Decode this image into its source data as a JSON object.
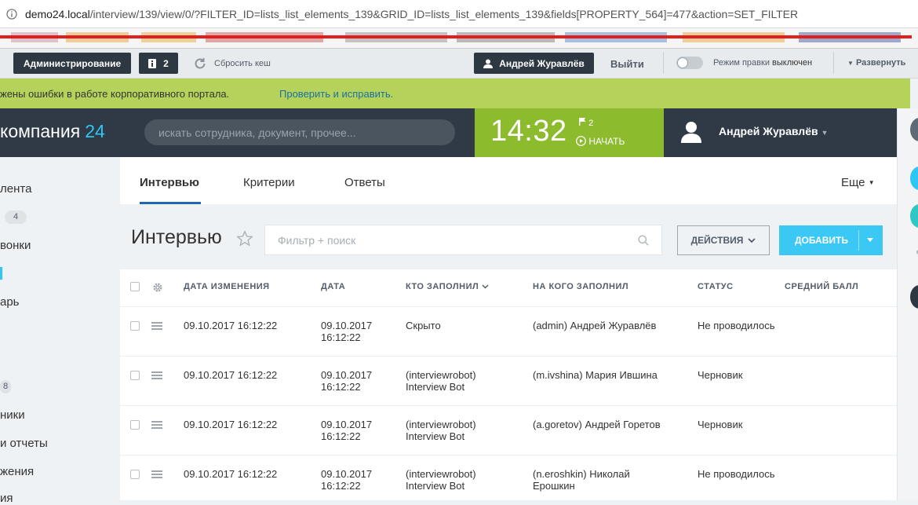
{
  "browser": {
    "url_host": "demo24.local",
    "url_rest": "/interview/139/view/0/?FILTER_ID=lists_list_elements_139&GRID_ID=lists_list_elements_139&fields[PROPERTY_564]=477&action=SET_FILTER"
  },
  "admin_bar": {
    "admin_label": "Администрирование",
    "notif_count": "2",
    "clear_cache": "Сбросить кеш",
    "user_name": "Андрей Журавлёв",
    "logout": "Выйти",
    "edit_mode_label": "Режим правки",
    "edit_mode_state": "выключен",
    "expand": "Развернуть"
  },
  "warning": {
    "message": "жены ошибки в работе корпоративного портала.",
    "link": "Проверить и исправить."
  },
  "header": {
    "logo_text": "компания",
    "logo_suffix": "24",
    "search_placeholder": "искать сотрудника, документ, прочее...",
    "time": "14:32",
    "flag_count": "2",
    "start_label": "НАЧАТЬ",
    "user_name": "Андрей Журавлёв"
  },
  "sidebar": {
    "items": [
      "лента",
      "вонки",
      "",
      "арь",
      "ники",
      "и отчеты",
      "жения",
      "ия"
    ],
    "counters": [
      "4",
      "8"
    ]
  },
  "tabs": [
    "Интервью",
    "Критерии",
    "Ответы"
  ],
  "tabs_more": "Еще",
  "page": {
    "title": "Интервью",
    "filter_placeholder": "Фильтр + поиск",
    "actions_label": "ДЕЙСТВИЯ",
    "add_label": "ДОБАВИТЬ"
  },
  "grid": {
    "columns": [
      "ДАТА ИЗМЕНЕНИЯ",
      "ДАТА",
      "КТО ЗАПОЛНИЛ",
      "НА КОГО ЗАПОЛНИЛ",
      "СТАТУС",
      "СРЕДНИЙ БАЛЛ"
    ],
    "rows": [
      {
        "modified": "09.10.2017 16:12:22",
        "date": "09.10.2017 16:12:22",
        "who": "Скрыто",
        "whom": "(admin) Андрей Журавлёв",
        "status": "Не проводилось",
        "score": ""
      },
      {
        "modified": "09.10.2017 16:12:22",
        "date": "09.10.2017 16:12:22",
        "who": "(interviewrobot) Interview Bot",
        "whom": "(m.ivshina) Мария Ившина",
        "status": "Черновик",
        "score": ""
      },
      {
        "modified": "09.10.2017 16:12:22",
        "date": "09.10.2017 16:12:22",
        "who": "(interviewrobot) Interview Bot",
        "whom": "(a.goretov) Андрей Горетов",
        "status": "Черновик",
        "score": ""
      },
      {
        "modified": "09.10.2017 16:12:22",
        "date": "09.10.2017 16:12:22",
        "who": "(interviewrobot) Interview Bot",
        "whom": "(n.eroshkin) Николай Ерошкин",
        "status": "Не проводилось",
        "score": ""
      }
    ]
  },
  "colors": {
    "dark": "#2f3a46",
    "clock_green": "#8dbb2e",
    "warn_green": "#b5d35a",
    "accent_blue": "#3bc8f5",
    "tab_underline": "#2067b0"
  }
}
